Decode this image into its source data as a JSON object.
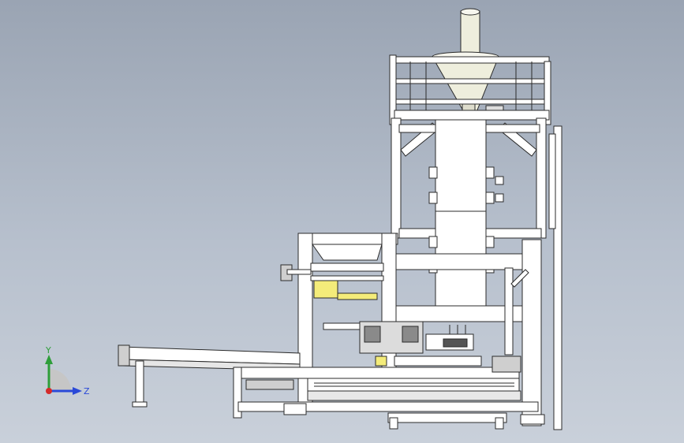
{
  "viewport": {
    "background_top": "#9aa4b3",
    "background_bottom": "#c9d0da",
    "model_stroke": "#2b2b2b",
    "model_fill": "#ffffff",
    "accent_yellow": "#f4ec7a",
    "hopper_fill": "#eeeedd"
  },
  "triad": {
    "y_label": "Y",
    "z_label": "Z",
    "y_color": "#2e9e3a",
    "z_color": "#2a49d8",
    "x_color": "#d42a2a"
  }
}
